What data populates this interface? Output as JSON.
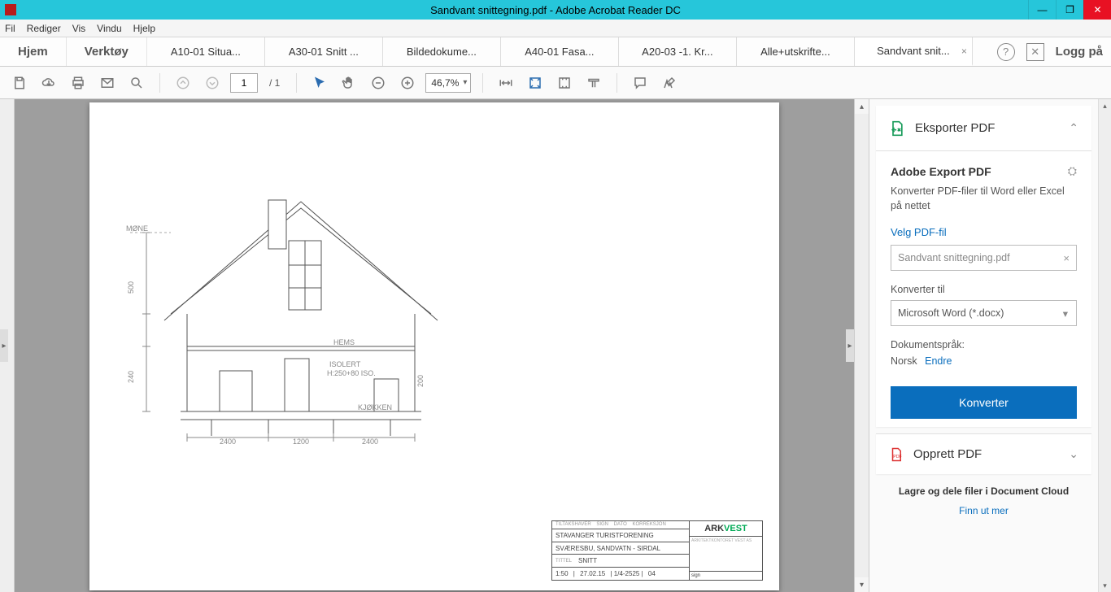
{
  "title": "Sandvant snittegning.pdf - Adobe Acrobat Reader DC",
  "menubar": [
    "Fil",
    "Rediger",
    "Vis",
    "Vindu",
    "Hjelp"
  ],
  "nav": {
    "home": "Hjem",
    "tools": "Verktøy"
  },
  "tabs": [
    "A10-01 Situa...",
    "A30-01 Snitt ...",
    "Bildedokume...",
    "A40-01 Fasa...",
    "A20-03 -1. Kr...",
    "Alle+utskrifte...",
    "Sandvant snit..."
  ],
  "active_tab_index": 6,
  "login": "Logg på",
  "toolbar": {
    "page_current": "1",
    "page_total": "/  1",
    "zoom": "46,7%"
  },
  "legend": {
    "client": "STAVANGER TURISTFORENING",
    "project": "SVÆRESBU, SANDVATN - SIRDAL",
    "title": "SNITT",
    "scale": "1:50",
    "date": "27.02.15",
    "drw": "04",
    "logo_a": "ARK",
    "logo_b": "VEST"
  },
  "panel": {
    "export_header": "Eksporter PDF",
    "section_title": "Adobe Export PDF",
    "desc": "Konverter PDF-filer til Word eller Excel på nettet",
    "select_file": "Velg PDF-fil",
    "file_name": "Sandvant snittegning.pdf",
    "convert_to_label": "Konverter til",
    "convert_to_value": "Microsoft Word (*.docx)",
    "doc_lang_label": "Dokumentspråk:",
    "doc_lang_value": "Norsk",
    "change": "Endre",
    "convert_btn": "Konverter",
    "create_pdf": "Opprett PDF",
    "footer_bold": "Lagre og dele filer i Document Cloud",
    "footer_more": "Finn ut mer"
  }
}
